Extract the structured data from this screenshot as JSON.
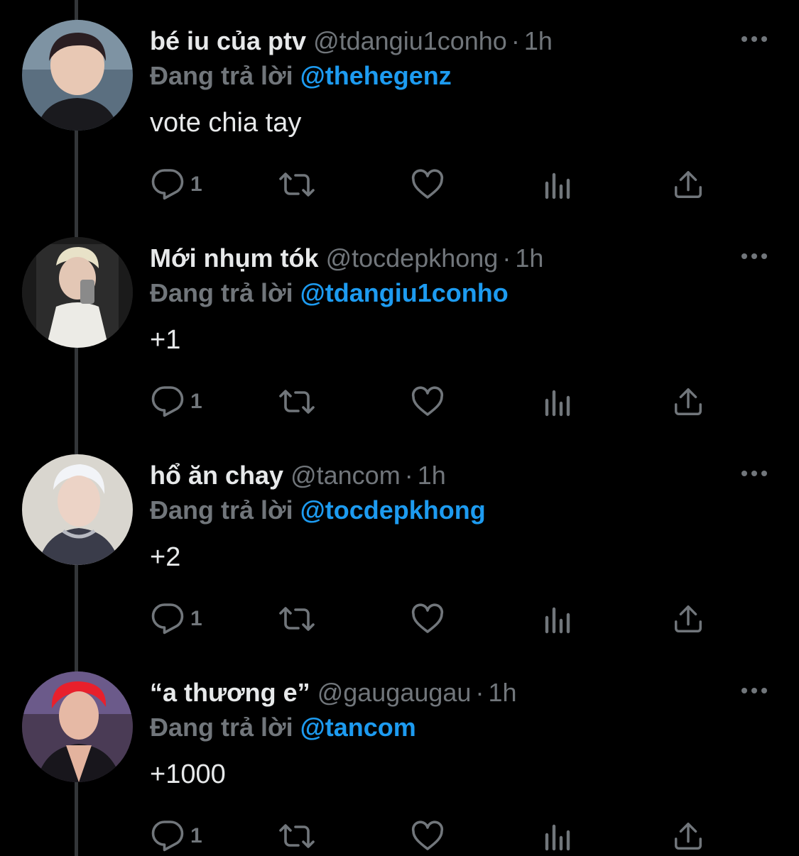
{
  "colors": {
    "background": "#000000",
    "primary_text": "#e7e9ea",
    "secondary_text": "#71767b",
    "accent": "#1d9bf0",
    "thread_line": "#333639"
  },
  "reply_prefix": "Đang trả lời",
  "separator": "·",
  "icons": [
    "reply-icon",
    "retweet-icon",
    "like-icon",
    "views-icon",
    "share-icon",
    "more-icon"
  ],
  "tweets": [
    {
      "display_name": "bé iu của ptv",
      "handle": "@tdangiu1conho",
      "time": "1h",
      "replying_to": "@thehegenz",
      "text": "vote chia tay",
      "reply_count": "1"
    },
    {
      "display_name": "Mới nhụm tók",
      "handle": "@tocdepkhong",
      "time": "1h",
      "replying_to": "@tdangiu1conho",
      "text": "+1",
      "reply_count": "1"
    },
    {
      "display_name": "hổ ăn chay",
      "handle": "@tancom",
      "time": "1h",
      "replying_to": "@tocdepkhong",
      "text": "+2",
      "reply_count": "1"
    },
    {
      "display_name": "“a thương e”",
      "handle": "@gaugaugau",
      "time": "1h",
      "replying_to": "@tancom",
      "text": "+1000",
      "reply_count": "1"
    }
  ]
}
